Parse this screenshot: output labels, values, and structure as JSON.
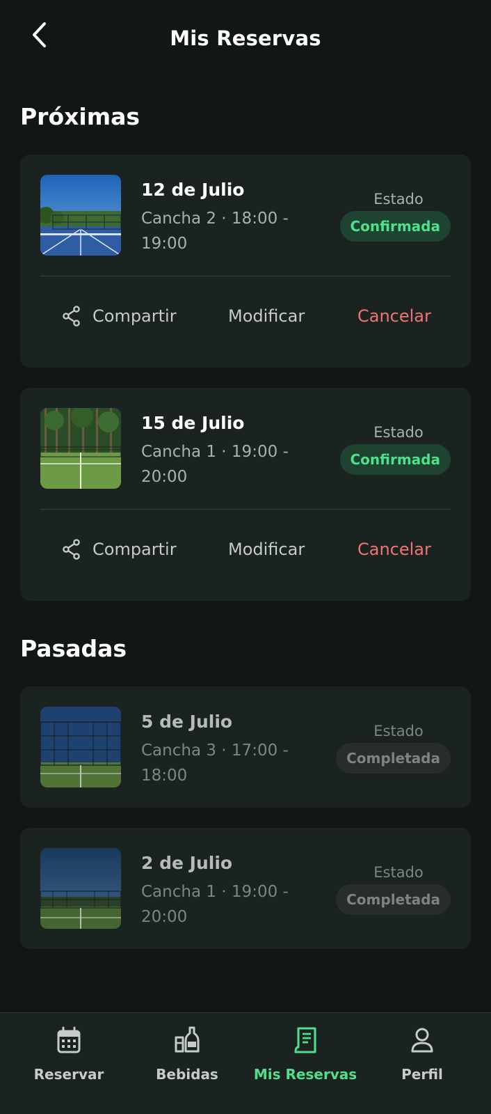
{
  "header": {
    "title": "Mis Reservas",
    "back_icon": "arrow-left-icon"
  },
  "sections": {
    "upcoming_title": "Próximas",
    "past_title": "Pasadas"
  },
  "upcoming": [
    {
      "date": "12 de Julio",
      "details": "Cancha 2 · 18:00 - 19:00",
      "status_label": "Estado",
      "status": "Confirmada",
      "actions": {
        "share": "Compartir",
        "modify": "Modificar",
        "cancel": "Cancelar"
      }
    },
    {
      "date": "15 de Julio",
      "details": "Cancha 1 · 19:00 - 20:00",
      "status_label": "Estado",
      "status": "Confirmada",
      "actions": {
        "share": "Compartir",
        "modify": "Modificar",
        "cancel": "Cancelar"
      }
    }
  ],
  "past": [
    {
      "date": "5 de Julio",
      "details": "Cancha 3 · 17:00 - 18:00",
      "status_label": "Estado",
      "status": "Completada"
    },
    {
      "date": "2 de Julio",
      "details": "Cancha 1 · 19:00 - 20:00",
      "status_label": "Estado",
      "status": "Completada"
    }
  ],
  "bottom_nav": [
    {
      "label": "Reservar",
      "icon": "calendar-icon",
      "active": false
    },
    {
      "label": "Bebidas",
      "icon": "drinks-icon",
      "active": false
    },
    {
      "label": "Mis Reservas",
      "icon": "receipt-icon",
      "active": true
    },
    {
      "label": "Perfil",
      "icon": "user-icon",
      "active": false
    }
  ],
  "colors": {
    "background": "#111716",
    "card": "#1b2321",
    "accent": "#4fe08b",
    "confirmed_bg": "#1e4331",
    "cancel": "#f07373"
  }
}
